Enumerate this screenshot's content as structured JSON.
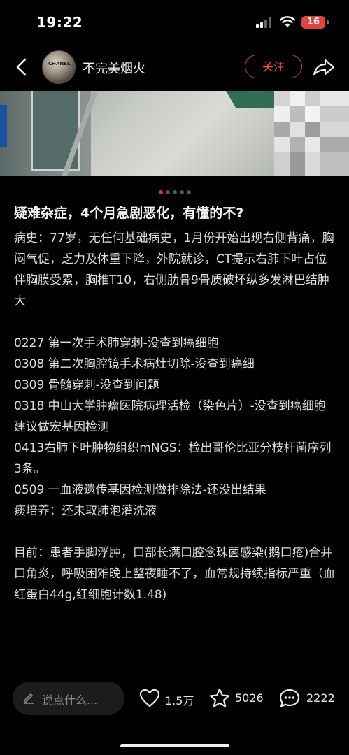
{
  "status_bar": {
    "time": "19:22",
    "battery": "16"
  },
  "header": {
    "username": "不完美烟火",
    "follow_label": "关注",
    "avatar_text": "CHANEL"
  },
  "pager": {
    "current": 1,
    "total": 5
  },
  "post": {
    "title": "疑难杂症，4个月急剧恶化，有懂的不?",
    "history": "病史：77岁，无任何基础病史，1月份开始出现右侧背痛，胸闷气促，乏力及体重下降，外院就诊，CT提示右肺下叶占位伴胸膜受累，胸椎T10，右侧肋骨9骨质破坏纵多发淋巴结肿大",
    "timeline": [
      "0227 第一次手术肺穿刺-没查到癌细胞",
      "0308 第二次胸腔镜手术病灶切除-没查到癌细",
      "0309 骨髓穿刺-没查到问题",
      "0318 中山大学肿瘤医院病理活检（染色片）-没查到癌细胞 建议做宏基因检测",
      "0413右肺下叶肿物组织mNGS：检出哥伦比亚分枝杆菌序列3条。",
      "0509 一血液遗传基因检测做排除法-还没出结果",
      "痰培养：还未取肺泡灌洗液"
    ],
    "current": "目前：患者手脚浮肿，口部长满口腔念珠菌感染(鹅口疮)合并口角炎，呼吸困难晚上整夜睡不了，血常规持续指标严重（血红蛋白44g,红细胞计数1.48)"
  },
  "bottom_bar": {
    "comment_placeholder": "说点什么...",
    "likes": "1.5万",
    "favorites": "5026",
    "comments": "2222"
  },
  "colors": {
    "accent": "#e0383e",
    "background": "#000000",
    "text": "#dedede"
  }
}
